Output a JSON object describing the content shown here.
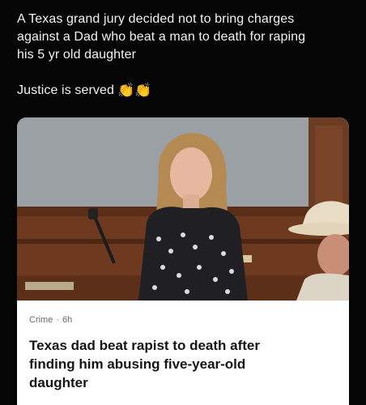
{
  "post": {
    "text_lines": [
      "A Texas grand jury decided not to bring charges",
      "against a Dad who beat a man to death for raping",
      "his 5 yr old daughter"
    ],
    "closing_text": "Justice is served",
    "closing_emoji": "👏👏"
  },
  "link_card": {
    "image_icon": "news-photo-courtroom",
    "category": "Crime",
    "separator": "·",
    "time_ago": "6h",
    "title_lines": [
      "Texas dad beat rapist to death after",
      "finding him abusing five-year-old",
      "daughter"
    ]
  },
  "colors": {
    "background": "#000000",
    "text": "#f2f2f2",
    "card_background": "#ffffff",
    "card_title": "#151515",
    "card_meta": "#6b6b6b"
  }
}
